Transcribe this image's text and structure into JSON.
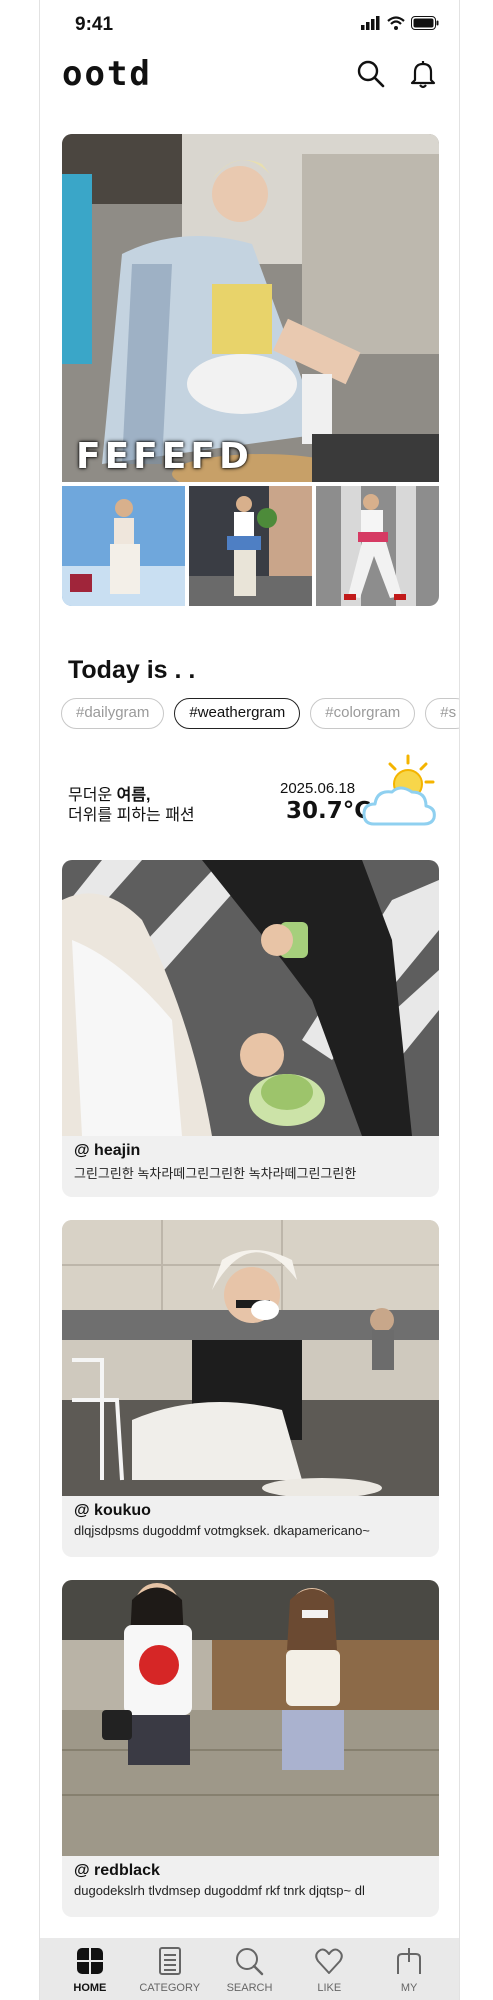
{
  "status_bar": {
    "time": "9:41",
    "icons": [
      "signal-icon",
      "wifi-icon",
      "battery-icon"
    ]
  },
  "header": {
    "logo": "ootd",
    "icons": [
      "search-icon",
      "bell-icon"
    ]
  },
  "hero": {
    "caption": "FEFEFD"
  },
  "today": {
    "title": "Today is . .",
    "tags": [
      "#dailygram",
      "#weathergram",
      "#colorgram",
      "#s"
    ],
    "active_tag_index": 1
  },
  "weather": {
    "line1_prefix": "무더운 ",
    "line1_bold": "여름,",
    "line2": "더위를 피하는 패션",
    "date": "2025.06.18",
    "temperature": "30.7°C",
    "icon": "sun-cloud-icon"
  },
  "feed": [
    {
      "user": "@ heajin",
      "desc": "그린그린한 녹차라떼그린그린한 녹차라떼그린그린한"
    },
    {
      "user": "@ koukuo",
      "desc": "dlqjsdpsms dugoddmf votmgksek. dkapamericano~"
    },
    {
      "user": "@ redblack",
      "desc": "dugodekslrh tlvdmsep dugoddmf rkf tnrk djqtsp~ dl"
    }
  ],
  "bottom_nav": [
    {
      "label": "HOME",
      "icon": "home-icon",
      "active": true
    },
    {
      "label": "CATEGORY",
      "icon": "category-icon",
      "active": false
    },
    {
      "label": "SEARCH",
      "icon": "search-icon",
      "active": false
    },
    {
      "label": "LIKE",
      "icon": "heart-icon",
      "active": false
    },
    {
      "label": "MY",
      "icon": "my-icon",
      "active": false
    }
  ],
  "colors": {
    "accent": "#111111",
    "tag_border": "#c8c8c8",
    "nav_bg": "#e9e9e9",
    "sun": "#f4b400",
    "cloud": "#8fd0f0"
  }
}
